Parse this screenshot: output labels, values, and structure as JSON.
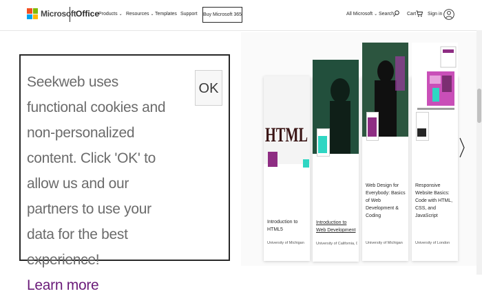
{
  "header": {
    "brand": "Microsoft",
    "product": "Office",
    "nav": [
      {
        "label": "Products",
        "has_menu": true
      },
      {
        "label": "Resources",
        "has_menu": true
      },
      {
        "label": "Templates",
        "has_menu": false
      },
      {
        "label": "Support",
        "has_menu": false
      }
    ],
    "buy_button": "Buy Microsoft 365",
    "all_microsoft": "All Microsoft",
    "search": "Search",
    "cart": "Cart",
    "signin": "Sign in"
  },
  "cookie_banner": {
    "message": "Seekweb uses functional cookies and non-personalized content. Click 'OK' to allow us and our partners to use your data for the best experience!",
    "learn_more": "Learn more",
    "ok_label": "OK"
  },
  "courses": [
    {
      "title": "Introduction to HTML5",
      "org": "University of Michigan",
      "thumb_text": "HTML",
      "linked": false
    },
    {
      "title": "Introduction to Web Development",
      "org": "University of California, Davis",
      "linked": true
    },
    {
      "title": "Web Design for Everybody: Basics of Web Development & Coding",
      "org": "University of Michigan",
      "linked": false
    },
    {
      "title": "Responsive Website Basics: Code with HTML, CSS, and JavaScript",
      "org": "University of London",
      "linked": false
    }
  ],
  "colors": {
    "ms_red": "#f25022",
    "ms_green": "#7fba00",
    "ms_blue": "#00a4ef",
    "ms_yellow": "#ffb900",
    "learn_more": "#6a1b79",
    "badge_purple": "#8e2d83",
    "badge_teal": "#2fd6c3"
  },
  "icons": [
    "chevron-down-icon",
    "search-icon",
    "cart-icon",
    "avatar-icon",
    "chevron-right-icon"
  ]
}
